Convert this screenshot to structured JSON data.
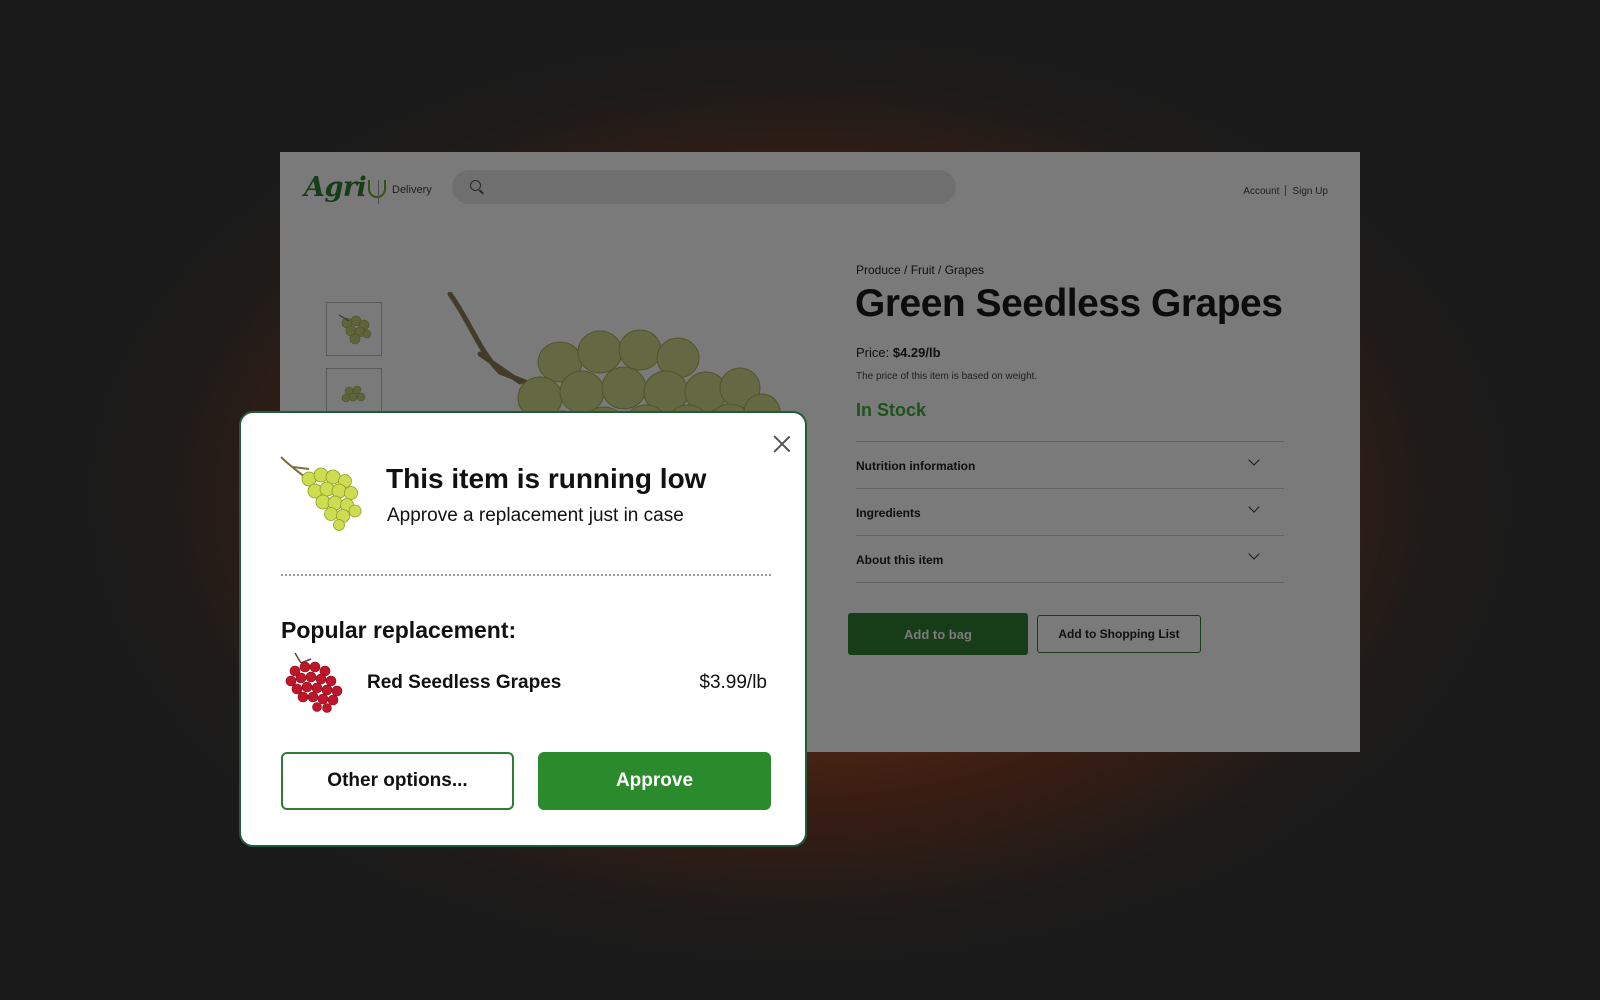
{
  "header": {
    "logo_text": "Agri",
    "delivery_label": "Delivery",
    "account_link": "Account",
    "signup_link": "Sign Up"
  },
  "product": {
    "breadcrumb": "Produce / Fruit / Grapes",
    "title": "Green Seedless Grapes",
    "price_label": "Price: ",
    "price_value": "$4.29/lb",
    "price_note": "The price of this item is based on weight.",
    "stock_status": "In Stock",
    "accordion": [
      {
        "label": "Nutrition information"
      },
      {
        "label": "Ingredients"
      },
      {
        "label": "About this item"
      }
    ],
    "add_to_bag_label": "Add to bag",
    "add_to_list_label": "Add to Shopping List"
  },
  "modal": {
    "title": "This item is running low",
    "subtitle": "Approve a replacement just in case",
    "popular_heading": "Popular replacement:",
    "replacement_name": "Red Seedless Grapes",
    "replacement_price": "$3.99/lb",
    "other_options_label": "Other options...",
    "approve_label": "Approve"
  },
  "colors": {
    "brand_green": "#2e7d32",
    "in_stock_green": "#3fae3f",
    "approve_green": "#2b8a2b",
    "modal_border": "#1f5c3a"
  },
  "icons": {
    "search": "search-icon",
    "close": "close-icon",
    "chevron": "chevron-down-icon"
  }
}
